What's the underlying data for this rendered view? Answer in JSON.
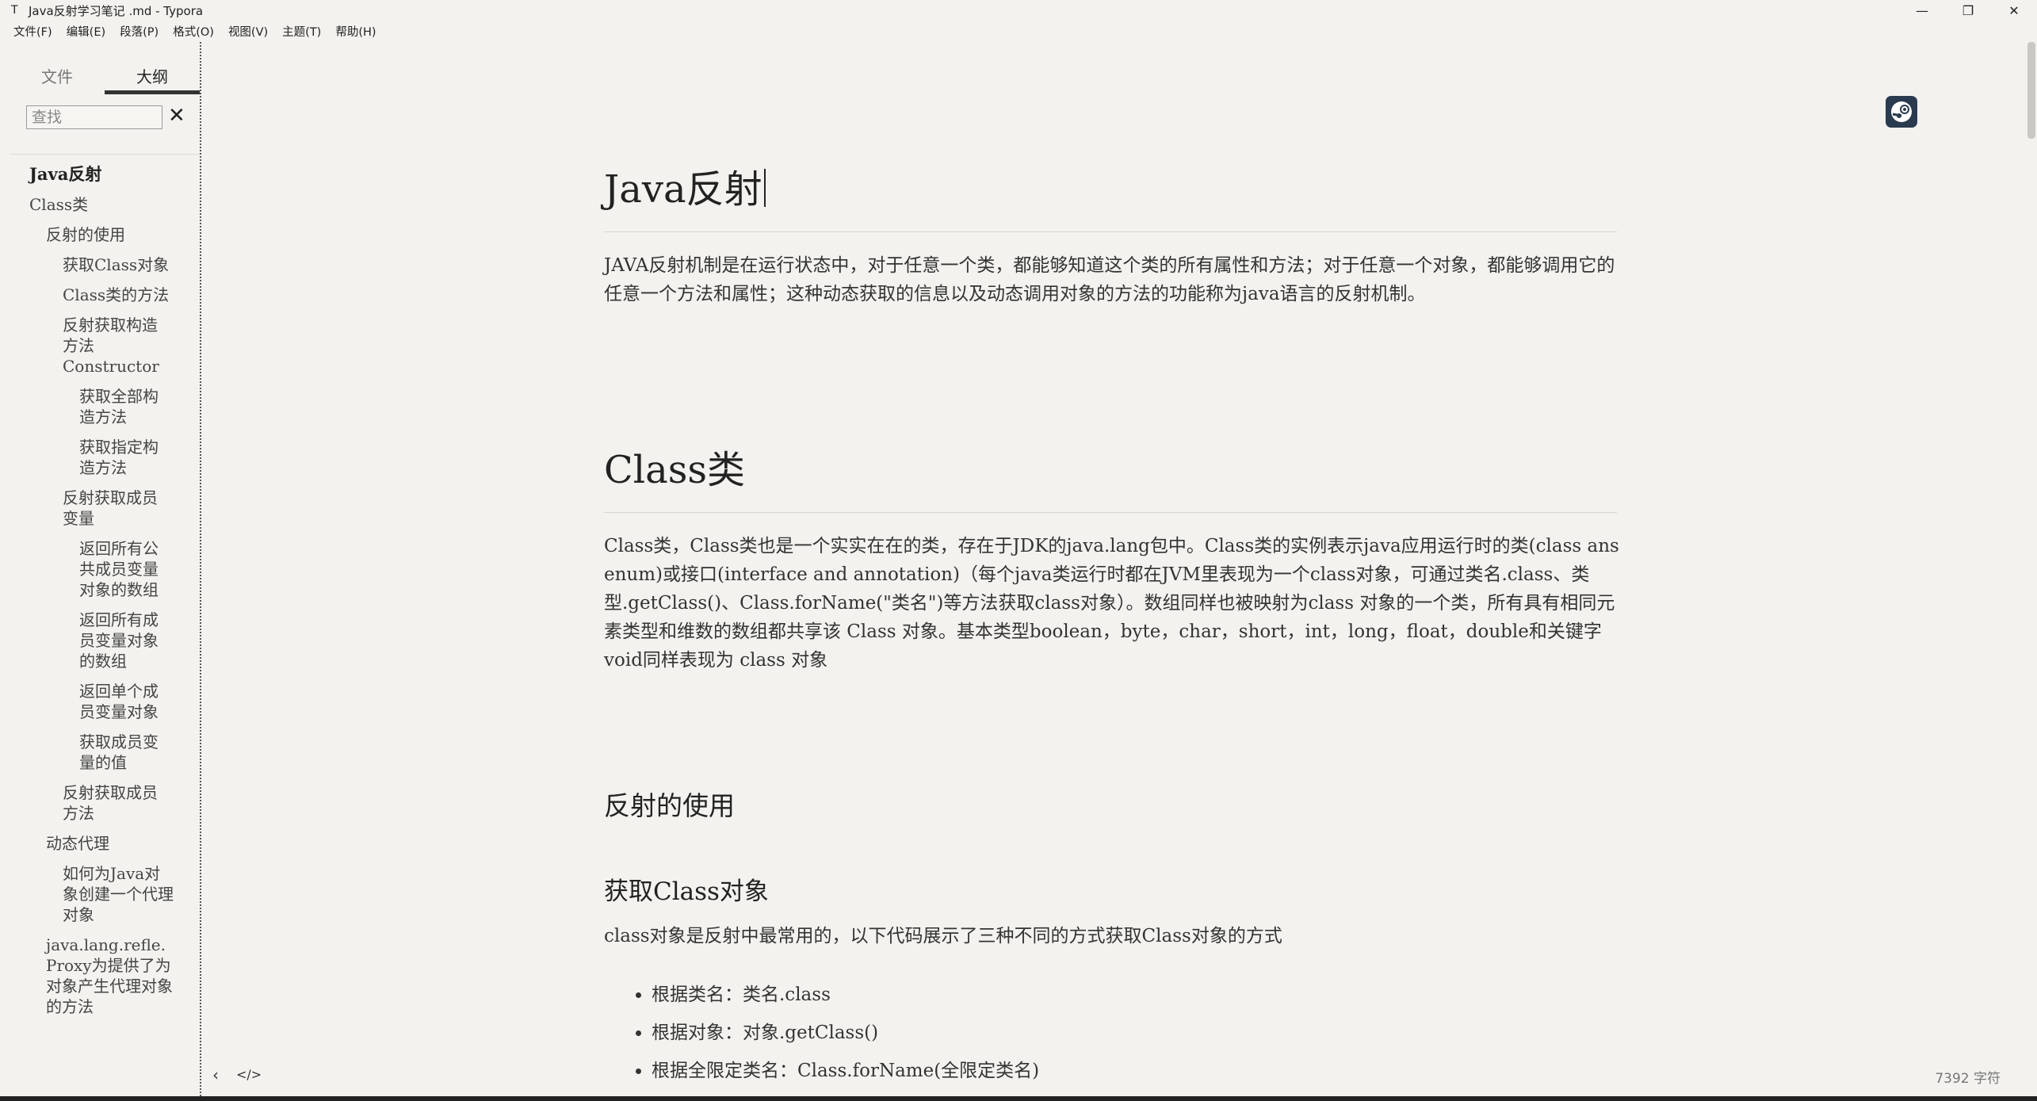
{
  "window": {
    "title": "Java反射学习笔记 .md - Typora",
    "app_icon": "T",
    "controls": [
      "—",
      "❐",
      "✕"
    ]
  },
  "menu": [
    "文件(F)",
    "编辑(E)",
    "段落(P)",
    "格式(O)",
    "视图(V)",
    "主题(T)",
    "帮助(H)"
  ],
  "sidebar": {
    "tabs": [
      "文件",
      "大纲"
    ],
    "active_tab": "大纲",
    "search_placeholder": "查找",
    "close_glyph": "✕",
    "outline": [
      {
        "level": 1,
        "text": "Java反射"
      },
      {
        "level": 2,
        "text": "Class类"
      },
      {
        "level": 3,
        "text": "反射的使用"
      },
      {
        "level": 4,
        "text": "获取Class对象"
      },
      {
        "level": 4,
        "text": "Class类的方法"
      },
      {
        "level": 4,
        "text": "反射获取构造方法Constructor"
      },
      {
        "level": 5,
        "text": "获取全部构造方法"
      },
      {
        "level": 5,
        "text": "获取指定构造方法"
      },
      {
        "level": 4,
        "text": "反射获取成员变量"
      },
      {
        "level": 5,
        "text": "返回所有公共成员变量对象的数组"
      },
      {
        "level": 5,
        "text": "返回所有成员变量对象的数组"
      },
      {
        "level": 5,
        "text": "返回单个成员变量对象"
      },
      {
        "level": 5,
        "text": "获取成员变量的值"
      },
      {
        "level": 4,
        "text": "反射获取成员方法"
      },
      {
        "level": 3,
        "text": "动态代理"
      },
      {
        "level": 4,
        "text": "如何为Java对象创建一个代理对象"
      },
      {
        "level": 3,
        "text": "java.lang.refle.Proxy为提供了为对象产生代理对象的方法"
      }
    ],
    "footer_icons": [
      "chevron-left-icon",
      "code-icon"
    ],
    "footer_glyphs": [
      "‹",
      "</>"
    ]
  },
  "document": {
    "h1": "Java反射",
    "intro": "JAVA反射机制是在运行状态中，对于任意一个类，都能够知道这个类的所有属性和方法；对于任意一个对象，都能够调用它的任意一个方法和属性；这种动态获取的信息以及动态调用对象的方法的功能称为java语言的反射机制。",
    "h2": "Class类",
    "class_para": "Class类，Class类也是一个实实在在的类，存在于JDK的java.lang包中。Class类的实例表示java应用运行时的类(class ans enum)或接口(interface and annotation)（每个java类运行时都在JVM里表现为一个class对象，可通过类名.class、类型.getClass()、Class.forName(\"类名\")等方法获取class对象）。数组同样也被映射为class 对象的一个类，所有具有相同元素类型和维数的数组都共享该 Class 对象。基本类型boolean，byte，char，short，int，long，float，double和关键字void同样表现为 class 对象",
    "h3": "反射的使用",
    "h4": "获取Class对象",
    "get_class_para": "class对象是反射中最常用的，以下代码展示了三种不同的方式获取Class对象的方式",
    "bullets": [
      "根据类名：类名.class",
      "根据对象：对象.getClass()",
      "根据全限定类名：Class.forName(全限定类名)"
    ]
  },
  "status": {
    "word_count": "7392 字符"
  }
}
